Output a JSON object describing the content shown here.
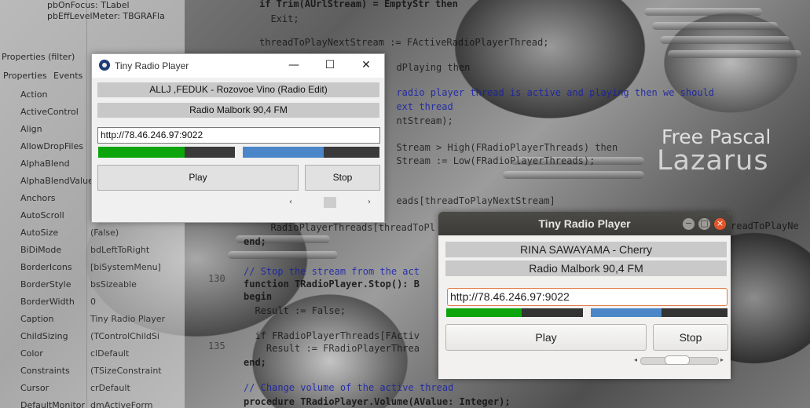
{
  "inspector": {
    "header_rows": [
      "pbOnFocus: TLabel",
      "pbEffLevelMeter: TBGRAFla"
    ],
    "tabs": [
      "Properties",
      "Events"
    ],
    "filter_label": "Properties (filter)",
    "properties": [
      {
        "name": "Action",
        "value": ""
      },
      {
        "name": "ActiveControl",
        "value": ""
      },
      {
        "name": "Align",
        "value": ""
      },
      {
        "name": "AllowDropFiles",
        "value": ""
      },
      {
        "name": "AlphaBlend",
        "value": ""
      },
      {
        "name": "AlphaBlendValue",
        "value": ""
      },
      {
        "name": "Anchors",
        "value": ""
      },
      {
        "name": "AutoScroll",
        "value": ""
      },
      {
        "name": "AutoSize",
        "value": "(False)"
      },
      {
        "name": "BiDiMode",
        "value": "bdLeftToRight"
      },
      {
        "name": "BorderIcons",
        "value": "[biSystemMenu]"
      },
      {
        "name": "BorderStyle",
        "value": "bsSizeable"
      },
      {
        "name": "BorderWidth",
        "value": "0"
      },
      {
        "name": "Caption",
        "value": "Tiny Radio Player"
      },
      {
        "name": "ChildSizing",
        "value": "(TControlChildSi"
      },
      {
        "name": "Color",
        "value": "clDefault"
      },
      {
        "name": "Constraints",
        "value": "(TSizeConstraint"
      },
      {
        "name": "Cursor",
        "value": "crDefault"
      },
      {
        "name": "DefaultMonitor",
        "value": "dmActiveForm"
      }
    ]
  },
  "code": {
    "lines": [
      {
        "text": "if Trim(AUrlStream) = EmptyStr then",
        "type": "kw"
      },
      {
        "text": "  Exit;",
        "type": "plain"
      },
      {
        "text": "threadToPlayNextStream := FActiveRadioPlayerThread;",
        "type": "plain"
      },
      {
        "text": "  dPlaying then",
        "type": "plain"
      },
      {
        "text": "  radio player thread is active and playing then we should",
        "type": "cm"
      },
      {
        "text": "  ext thread",
        "type": "cm"
      },
      {
        "text": "  ntStream);",
        "type": "plain"
      },
      {
        "text": "  Stream > High(FRadioPlayerThreads) then",
        "type": "plain"
      },
      {
        "text": "  Stream := Low(FRadioPlayerThreads);",
        "type": "plain"
      },
      {
        "text": "  eads[threadToPlayNextStream]",
        "type": "plain"
      },
      {
        "text": "  RadioPlayerThreads[threadToPl",
        "type": "plain"
      },
      {
        "text": "end;",
        "type": "kw"
      },
      {
        "text": "// Stop the stream from the act",
        "type": "cm"
      },
      {
        "text": "function TRadioPlayer.Stop(): B",
        "type": "kw"
      },
      {
        "text": "begin",
        "type": "kw"
      },
      {
        "text": "  Result := False;",
        "type": "plain"
      },
      {
        "text": "  if FRadioPlayerThreads[FActiv",
        "type": "plain"
      },
      {
        "text": "    Result := FRadioPlayerThrea",
        "type": "plain"
      },
      {
        "text": "end;",
        "type": "kw"
      },
      {
        "text": "// Change volume of the active thread",
        "type": "cm"
      },
      {
        "text": "procedure TRadioPlayer.Volume(AValue: Integer);",
        "type": "kw"
      }
    ],
    "line_numbers": [
      "130",
      "135"
    ],
    "overflow_text": "readToPlayNe"
  },
  "brand": {
    "line1": "Free Pascal",
    "line2": "Lazarus"
  },
  "win1": {
    "title": "Tiny Radio Player",
    "controls": {
      "minimize": "—",
      "maximize": "☐",
      "close": "✕"
    },
    "song": "ALLJ ,FEDUK - Rozovoe Vino (Radio Edit)",
    "station": "Radio Malbork 90,4 FM",
    "url": "http://78.46.246.97:9022",
    "level_left": 0.63,
    "level_right": 0.59,
    "level_left_color": "#0ca60c",
    "level_right_color": "#4a86c8",
    "play_label": "Play",
    "stop_label": "Stop",
    "scroll_left": "‹",
    "scroll_right": "›"
  },
  "win2": {
    "title": "Tiny Radio Player",
    "song": "RINA SAWAYAMA - Cherry",
    "station": "Radio Malbork 90,4 FM",
    "url": "http://78.46.246.97:9022",
    "level_left": 0.55,
    "level_right": 0.52,
    "level_left_color": "#0ca60c",
    "level_right_color": "#4a86c8",
    "play_label": "Play",
    "stop_label": "Stop",
    "controls": {
      "minimize": "−",
      "maximize": "□",
      "close": "×"
    },
    "close_color": "#e2562b",
    "scroll_left": "◂",
    "scroll_right": "▸"
  }
}
